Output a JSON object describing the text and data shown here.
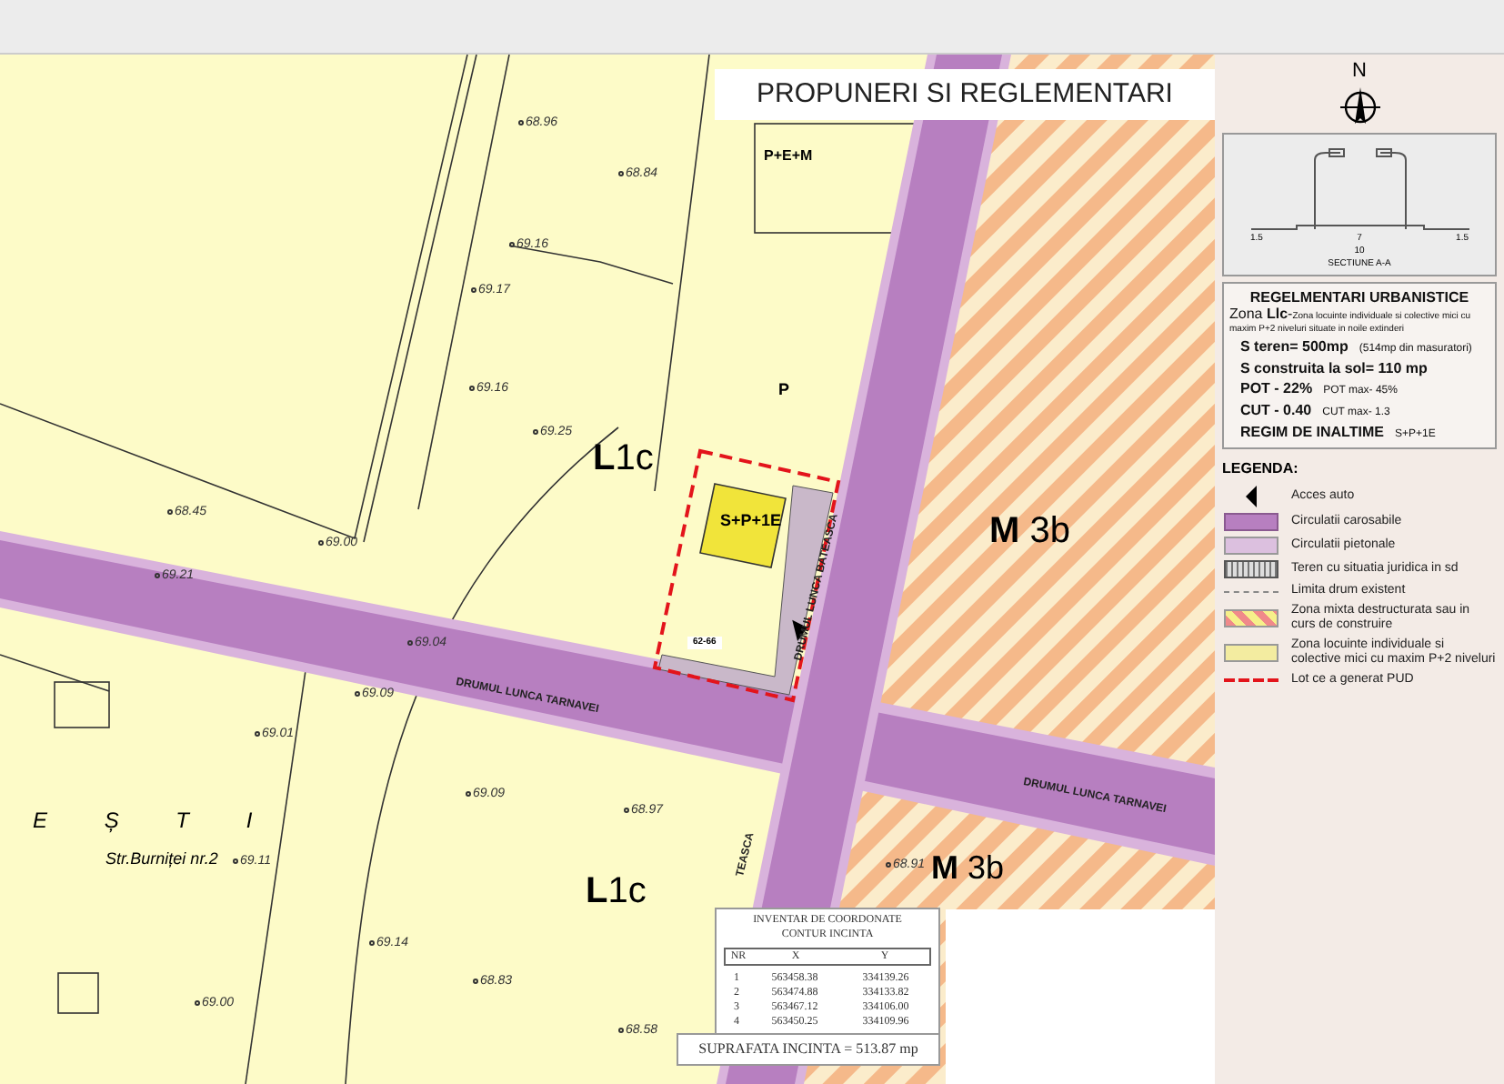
{
  "map": {
    "title": "PROPUNERI SI REGLEMENTARI",
    "zones": [
      {
        "label": "**L**1c"
      },
      {
        "label": "**M** 3b"
      },
      {
        "label": "P+E+M"
      },
      {
        "label": "P"
      },
      {
        "label": "S+P+1E"
      },
      {
        "label": "**L**1c"
      },
      {
        "label": "**M** 3b"
      }
    ],
    "streets": [
      {
        "name": "DRUMUL LUNCA TARNAVEI"
      },
      {
        "name": "DRUMUL LUNCA BATEASCA"
      },
      {
        "name": "DRUMUL LUNCA TARNAVEI"
      },
      {
        "name": "TEASCA"
      }
    ],
    "lot_number": "62-66",
    "locality": "E Ș T I",
    "address": "Str.Burniței nr.2",
    "elevations": [
      "68.96",
      "68.84",
      "69.16",
      "69.17",
      "69.16",
      "69.25",
      "68.45",
      "69.00",
      "69.21",
      "69.04",
      "69.09",
      "69.01",
      "69.09",
      "68.97",
      "69.11",
      "69.14",
      "68.83",
      "69.00",
      "68.58",
      "68.91"
    ],
    "coordinates": {
      "title": "INVENTAR DE COORDONATE CONTUR INCINTA",
      "columns": [
        "NR",
        "X",
        "Y"
      ],
      "rows": [
        [
          "1",
          "563458.38",
          "334139.26"
        ],
        [
          "2",
          "563474.88",
          "334133.82"
        ],
        [
          "3",
          "563467.12",
          "334106.00"
        ],
        [
          "4",
          "563450.25",
          "334109.96"
        ]
      ]
    },
    "surface": "SUPRAFATA INCINTA = 513.87 mp"
  },
  "panel": {
    "north": "N",
    "section": {
      "widths": [
        "1.5",
        "7",
        "1.5"
      ],
      "total": "10",
      "caption": "SECTIUNE A-A"
    },
    "regulations": {
      "title": "REGELMENTARI URBANISTICE",
      "zone_label": "Zona **Llc**-",
      "zone_description": "Zona locuinte individuale si colective mici cu maxim P+2 niveluri situate in noile extinderi",
      "lines": [
        {
          "main": "S teren= 500mp",
          "note": "(514mp din masuratori)"
        },
        {
          "main": "S construita la sol= 110 mp"
        },
        {
          "main": "POT  - 22%",
          "note": "POT max- 45%"
        },
        {
          "main": "CUT  - 0.40",
          "note": "CUT max- 1.3"
        },
        {
          "main": "REGIM DE INALTIME",
          "note": "S+P+1E"
        }
      ]
    },
    "legend": {
      "title": "LEGENDA:",
      "items": [
        {
          "kind": "arrow",
          "label": "Acces auto"
        },
        {
          "kind": "road",
          "label": "Circulatii carosabile"
        },
        {
          "kind": "pedestrian",
          "label": "Circulatii pietonale"
        },
        {
          "kind": "grid",
          "label": "Teren cu situatia juridica in sd"
        },
        {
          "kind": "dotted",
          "label": "Limita drum existent"
        },
        {
          "kind": "hatch",
          "label": "Zona mixta destructurata sau in curs de construire"
        },
        {
          "kind": "yellow",
          "label": "Zona locuinte individuale si colective mici cu maxim P+2 niveluri"
        },
        {
          "kind": "dashed",
          "label": "Lot ce a generat PUD"
        }
      ]
    }
  }
}
